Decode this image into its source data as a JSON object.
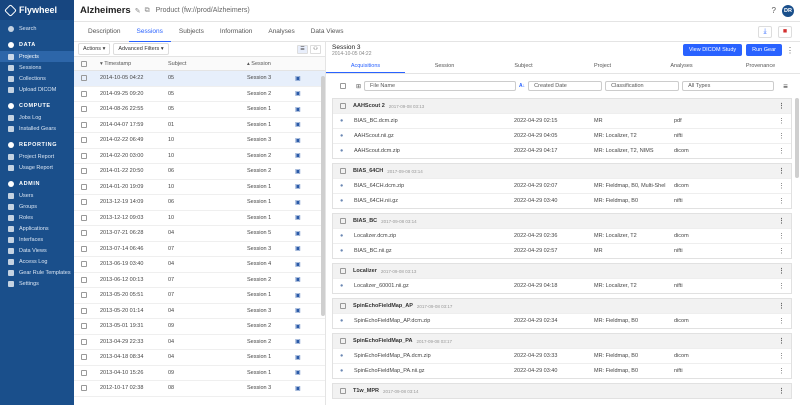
{
  "brand": "Flywheel",
  "sidebar": {
    "search": "Search",
    "data_section": "DATA",
    "data_items": [
      "Projects",
      "Sessions",
      "Collections",
      "Upload DICOM"
    ],
    "compute_section": "COMPUTE",
    "compute_items": [
      "Jobs Log",
      "Installed Gears"
    ],
    "reporting_section": "REPORTING",
    "reporting_items": [
      "Project Report",
      "Usage Report"
    ],
    "admin_section": "ADMIN",
    "admin_items": [
      "Users",
      "Groups",
      "Roles",
      "Applications",
      "Interfaces",
      "Data Views",
      "Access Log",
      "Gear Rule Templates",
      "Settings"
    ]
  },
  "header": {
    "title": "Alzheimers",
    "path": "Product (fw://prod/Alzheimers)",
    "help": "?",
    "avatar": "DR"
  },
  "tabs": [
    "Description",
    "Sessions",
    "Subjects",
    "Information",
    "Analyses",
    "Data Views"
  ],
  "left": {
    "actions": "Actions ▾",
    "advanced_filters": "Advanced Filters ▾",
    "columns": {
      "timestamp": "Timestamp",
      "subject": "Subject",
      "session": "Session"
    },
    "rows": [
      {
        "ts": "2014-10-05 04:22",
        "sub": "05",
        "ses": "Session 3"
      },
      {
        "ts": "2014-09-25 09:20",
        "sub": "05",
        "ses": "Session 2"
      },
      {
        "ts": "2014-08-26 22:55",
        "sub": "05",
        "ses": "Session 1"
      },
      {
        "ts": "2014-04-07 17:59",
        "sub": "01",
        "ses": "Session 1"
      },
      {
        "ts": "2014-02-22 06:49",
        "sub": "10",
        "ses": "Session 3"
      },
      {
        "ts": "2014-02-20 03:00",
        "sub": "10",
        "ses": "Session 2"
      },
      {
        "ts": "2014-01-22 20:50",
        "sub": "06",
        "ses": "Session 2"
      },
      {
        "ts": "2014-01-20 19:09",
        "sub": "10",
        "ses": "Session 1"
      },
      {
        "ts": "2013-12-19 14:09",
        "sub": "06",
        "ses": "Session 1"
      },
      {
        "ts": "2013-12-12 09:03",
        "sub": "10",
        "ses": "Session 1"
      },
      {
        "ts": "2013-07-21 06:28",
        "sub": "04",
        "ses": "Session 5"
      },
      {
        "ts": "2013-07-14 06:46",
        "sub": "07",
        "ses": "Session 3"
      },
      {
        "ts": "2013-06-19 03:40",
        "sub": "04",
        "ses": "Session 4"
      },
      {
        "ts": "2013-06-12 00:13",
        "sub": "07",
        "ses": "Session 2"
      },
      {
        "ts": "2013-05-20 05:51",
        "sub": "07",
        "ses": "Session 1"
      },
      {
        "ts": "2013-05-20 01:14",
        "sub": "04",
        "ses": "Session 3"
      },
      {
        "ts": "2013-05-01 19:31",
        "sub": "09",
        "ses": "Session 2"
      },
      {
        "ts": "2013-04-29 22:33",
        "sub": "04",
        "ses": "Session 2"
      },
      {
        "ts": "2013-04-18 08:34",
        "sub": "04",
        "ses": "Session 1"
      },
      {
        "ts": "2013-04-10 15:26",
        "sub": "09",
        "ses": "Session 1"
      },
      {
        "ts": "2012-10-17 02:38",
        "sub": "08",
        "ses": "Session 3"
      }
    ]
  },
  "right": {
    "title": "Session 3",
    "date": "2014-10-05 04:22",
    "view_dicom": "View DICOM Study",
    "run_gear": "Run Gear",
    "tabs": [
      "Acquisitions",
      "Session",
      "Subject",
      "Project",
      "Analyses",
      "Provenance"
    ],
    "filters": {
      "file_name": "File Name",
      "created_date": "Created Date",
      "classification": "Classification",
      "all_types": "All Types"
    },
    "groups": [
      {
        "name": "AAHScout 2",
        "date": "2017-09-08 03:13",
        "files": [
          {
            "n": "BIAS_BC.dcm.zip",
            "d": "2022-04-29 02:15",
            "c": "MR",
            "t": "pdf"
          },
          {
            "n": "AAHScout.nii.gz",
            "d": "2022-04-29 04:05",
            "c": "MR: Localizer, T2",
            "t": "nifti"
          },
          {
            "n": "AAHScout.dcm.zip",
            "d": "2022-04-29 04:17",
            "c": "MR: Localizer, T2, NIMS",
            "t": "dicom"
          }
        ]
      },
      {
        "name": "BIAS_64CH",
        "date": "2017-09-08 03:14",
        "files": [
          {
            "n": "BIAS_64CH.dcm.zip",
            "d": "2022-04-29 02:07",
            "c": "MR: Fieldmap, B0, Multi-Shel",
            "t": "dicom"
          },
          {
            "n": "BIAS_64CH.nii.gz",
            "d": "2022-04-29 03:40",
            "c": "MR: Fieldmap, B0",
            "t": "nifti"
          }
        ]
      },
      {
        "name": "BIAS_BC",
        "date": "2017-09-08 03:14",
        "files": [
          {
            "n": "Localizer.dcm.zip",
            "d": "2022-04-29 02:36",
            "c": "MR: Localizer, T2",
            "t": "dicom"
          },
          {
            "n": "BIAS_BC.nii.gz",
            "d": "2022-04-29 02:57",
            "c": "MR",
            "t": "nifti"
          }
        ]
      },
      {
        "name": "Localizer",
        "date": "2017-09-08 03:13",
        "files": [
          {
            "n": "Localizer_60001.nii.gz",
            "d": "2022-04-29 04:18",
            "c": "MR: Localizer, T2",
            "t": "nifti"
          }
        ]
      },
      {
        "name": "SpinEchoFieldMap_AP",
        "date": "2017-09-08 03:17",
        "files": [
          {
            "n": "SpinEchoFieldMap_AP.dcm.zip",
            "d": "2022-04-29 02:34",
            "c": "MR: Fieldmap, B0",
            "t": "dicom"
          }
        ]
      },
      {
        "name": "SpinEchoFieldMap_PA",
        "date": "2017-09-08 03:17",
        "files": [
          {
            "n": "SpinEchoFieldMap_PA.dcm.zip",
            "d": "2022-04-29 03:33",
            "c": "MR: Fieldmap, B0",
            "t": "dicom"
          },
          {
            "n": "SpinEchoFieldMap_PA.nii.gz",
            "d": "2022-04-29 03:40",
            "c": "MR: Fieldmap, B0",
            "t": "nifti"
          }
        ]
      },
      {
        "name": "T1w_MPR",
        "date": "2017-09-08 03:14",
        "files": []
      }
    ]
  }
}
